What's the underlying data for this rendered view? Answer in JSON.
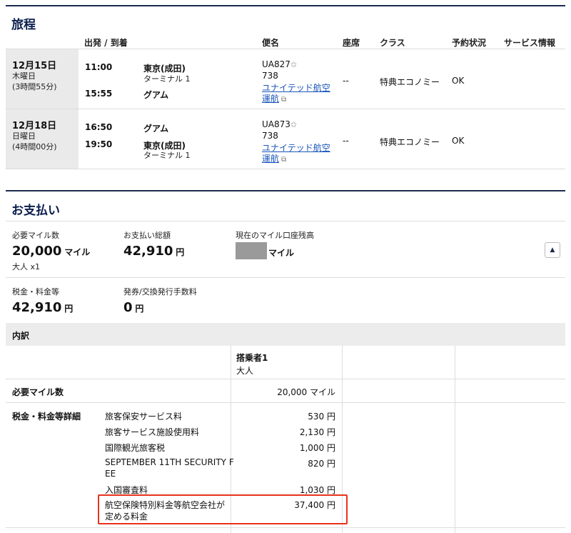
{
  "itinerary": {
    "title": "旅程",
    "columns": {
      "depart_arrive": "出発 / 到着",
      "flight": "便名",
      "seat": "座席",
      "class": "クラス",
      "status": "予約状況",
      "service": "サービス情報"
    },
    "segments": [
      {
        "date": "12月15日",
        "weekday": "木曜日",
        "duration": "(3時間55分)",
        "dep_time": "11:00",
        "dep_place": "東京(成田)",
        "dep_terminal": "ターミナル 1",
        "arr_time": "15:55",
        "arr_place": "グアム",
        "arr_terminal": "",
        "flight_no": "UA827",
        "aircraft": "738",
        "operator_line1": "ユナイテッド航空",
        "operator_line2": "運航",
        "seat": "--",
        "class": "特典エコノミー",
        "status": "OK"
      },
      {
        "date": "12月18日",
        "weekday": "日曜日",
        "duration": "(4時間00分)",
        "dep_time": "16:50",
        "dep_place": "グアム",
        "dep_terminal": "",
        "arr_time": "19:50",
        "arr_place": "東京(成田)",
        "arr_terminal": "ターミナル 1",
        "flight_no": "UA873",
        "aircraft": "738",
        "operator_line1": "ユナイテッド航空",
        "operator_line2": "運航",
        "seat": "--",
        "class": "特典エコノミー",
        "status": "OK"
      }
    ]
  },
  "payment": {
    "title": "お支払い",
    "miles_required_label": "必要マイル数",
    "miles_required_value": "20,000",
    "miles_unit": "マイル",
    "passenger_note": "大人 x1",
    "total_label": "お支払い総額",
    "total_value": "42,910",
    "yen_unit": "円",
    "balance_label": "現在のマイル口座残高",
    "balance_unit": "マイル",
    "taxes_label": "税金・料金等",
    "taxes_value": "42,910",
    "fee_label": "発券/交換発行手数料",
    "fee_value": "0",
    "collapse_icon": "▲"
  },
  "breakdown": {
    "title": "内訳",
    "passenger_header": "搭乗者1",
    "passenger_type": "大人",
    "miles_row_label": "必要マイル数",
    "miles_row_value": "20,000 マイル",
    "tax_section_label": "税金・料金等詳細",
    "items": [
      {
        "name": "旅客保安サービス料",
        "amount": "530 円"
      },
      {
        "name": "旅客サービス施設使用料",
        "amount": "2,130 円"
      },
      {
        "name": "国際観光旅客税",
        "amount": "1,000 円"
      },
      {
        "name": "SEPTEMBER 11TH SECURITY F",
        "name2": "EE",
        "amount": "820 円"
      },
      {
        "name": "入国審査料",
        "amount": "1,030 円"
      },
      {
        "name": "航空保険特別料金等航空会社が",
        "name2": "定める料金",
        "amount": "37,400 円"
      }
    ],
    "highlight_color": "#e8331c"
  }
}
